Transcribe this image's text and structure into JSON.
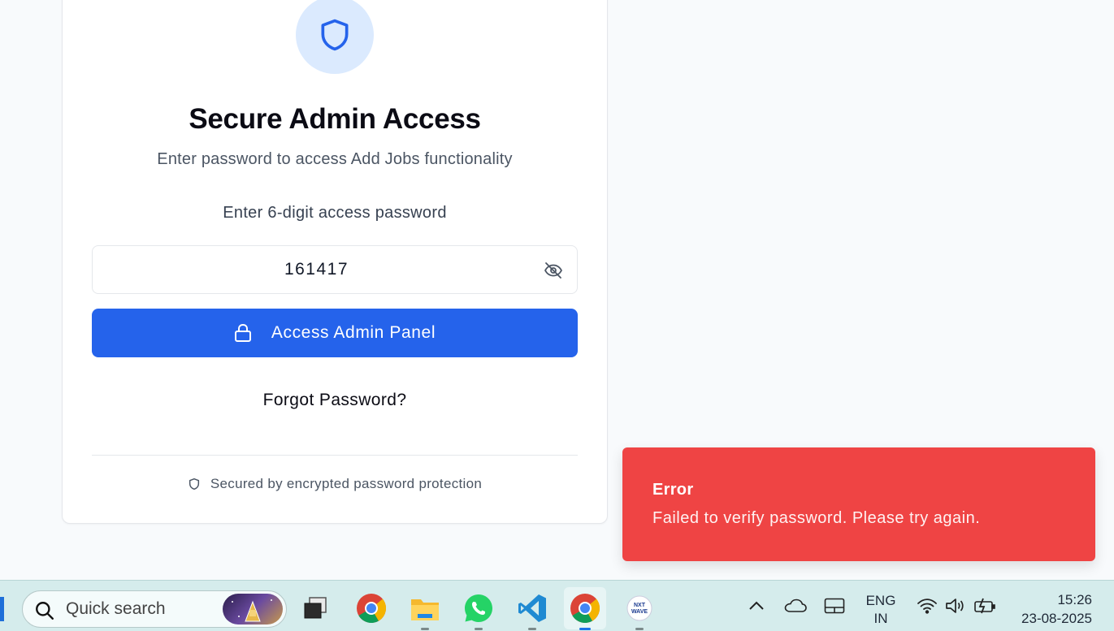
{
  "card": {
    "title": "Secure Admin Access",
    "subtitle": "Enter password to access Add Jobs functionality",
    "password_label": "Enter 6-digit access password",
    "password_value": "161417",
    "access_button": "Access Admin Panel",
    "forgot_link": "Forgot Password?",
    "footer_note": "Secured by encrypted password protection",
    "icons": [
      "shield-icon",
      "eye-off-icon",
      "lock-icon",
      "small-shield-icon"
    ]
  },
  "toast": {
    "title": "Error",
    "message": "Failed to verify password. Please try again.",
    "color": "#ef4444"
  },
  "taskbar": {
    "search_placeholder": "Quick search",
    "apps": [
      "task-view",
      "chrome",
      "file-explorer",
      "whatsapp",
      "vscode",
      "chrome-active",
      "nxtwave"
    ],
    "nxtwave_label": "NXT WAVE",
    "language_line1": "ENG",
    "language_line2": "IN",
    "time": "15:26",
    "date": "23-08-2025"
  },
  "colors": {
    "accent": "#2563eb",
    "error": "#ef4444",
    "shield_bg": "#dbeafe",
    "taskbar_bg": "#d5ecec"
  }
}
